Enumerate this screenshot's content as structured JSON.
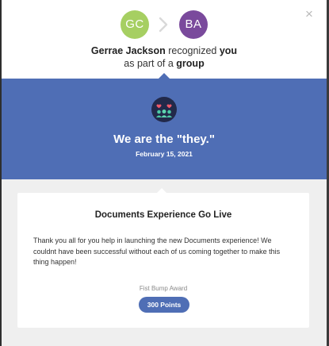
{
  "header": {
    "close_glyph": "×",
    "giver": {
      "initials": "GC",
      "color": "#a6cf62"
    },
    "receiver": {
      "initials": "BA",
      "color": "#7a4a9c"
    },
    "giver_name": "Gerrae Jackson",
    "recognized_word": "recognized",
    "you_word": "you",
    "as_part_of": "as part of a",
    "group_word": "group"
  },
  "banner": {
    "icon": "group-hearts-icon",
    "title": "We are the \"they.\"",
    "date": "February 15, 2021",
    "color": "#4f6eb5"
  },
  "card": {
    "title": "Documents Experience Go Live",
    "message": "Thank you all for you help in launching the new Documents experience! We couldnt have been successful without each of us coming together to make this thing happen!",
    "award_label": "Fist Bump Award",
    "points_label": "300 Points"
  }
}
